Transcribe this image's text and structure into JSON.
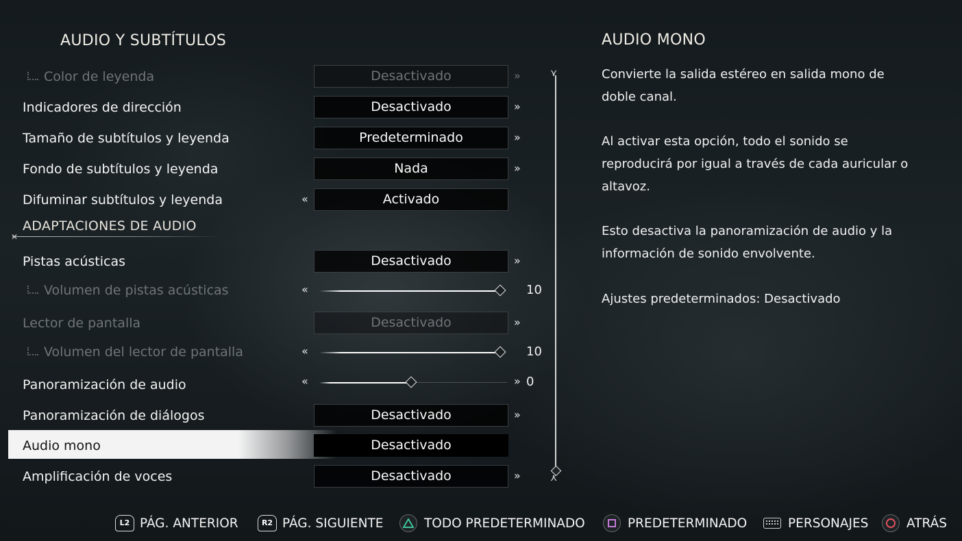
{
  "left": {
    "title": "AUDIO Y SUBTÍTULOS",
    "rows": [
      {
        "label": "Color de leyenda",
        "value": "Desactivado"
      },
      {
        "label": "Indicadores de dirección",
        "value": "Desactivado"
      },
      {
        "label": "Tamaño de subtítulos y leyenda",
        "value": "Predeterminado"
      },
      {
        "label": "Fondo de subtítulos y leyenda",
        "value": "Nada"
      },
      {
        "label": "Difuminar subtítulos y leyenda",
        "value": "Activado"
      },
      {
        "label": "Pistas acústicas",
        "value": "Desactivado"
      },
      {
        "label": "Volumen de pistas acústicas",
        "value": "10"
      },
      {
        "label": "Lector de pantalla",
        "value": "Desactivado"
      },
      {
        "label": "Volumen del lector de pantalla",
        "value": "10"
      },
      {
        "label": "Panoramización de audio",
        "value": "0"
      },
      {
        "label": "Panoramización de diálogos",
        "value": "Desactivado"
      },
      {
        "label": "Audio mono",
        "value": "Desactivado"
      },
      {
        "label": "Amplificación de voces",
        "value": "Desactivado"
      }
    ],
    "section": "ADAPTACIONES DE AUDIO",
    "sliders": {
      "pistas_fill": 1.0,
      "lector_fill": 1.0,
      "panorama_fill": 0.5
    },
    "arrows": {
      "right": "»",
      "left": "«"
    },
    "scroll_caps": {
      "top": "⋎",
      "bottom": "⋏"
    }
  },
  "right": {
    "title": "AUDIO MONO",
    "p1": "Convierte la salida estéreo en salida mono de doble canal.",
    "p2": "Al activar esta opción, todo el sonido se reproducirá por igual a través de cada auricular o altavoz.",
    "p3": "Esto desactiva la panoramización de audio y la información de sonido envolvente.",
    "p4": "Ajustes predeterminados: Desactivado"
  },
  "footer": {
    "l2": "L2",
    "prev": "PÁG. ANTERIOR",
    "r2": "R2",
    "next": "PÁG. SIGUIENTE",
    "all_default": "TODO PREDETERMINADO",
    "default": "PREDETERMINADO",
    "characters": "PERSONAJES",
    "back": "ATRÁS"
  },
  "colors": {
    "triangle": "#3fc29b",
    "square": "#c57ad8",
    "circle": "#e2505f"
  }
}
